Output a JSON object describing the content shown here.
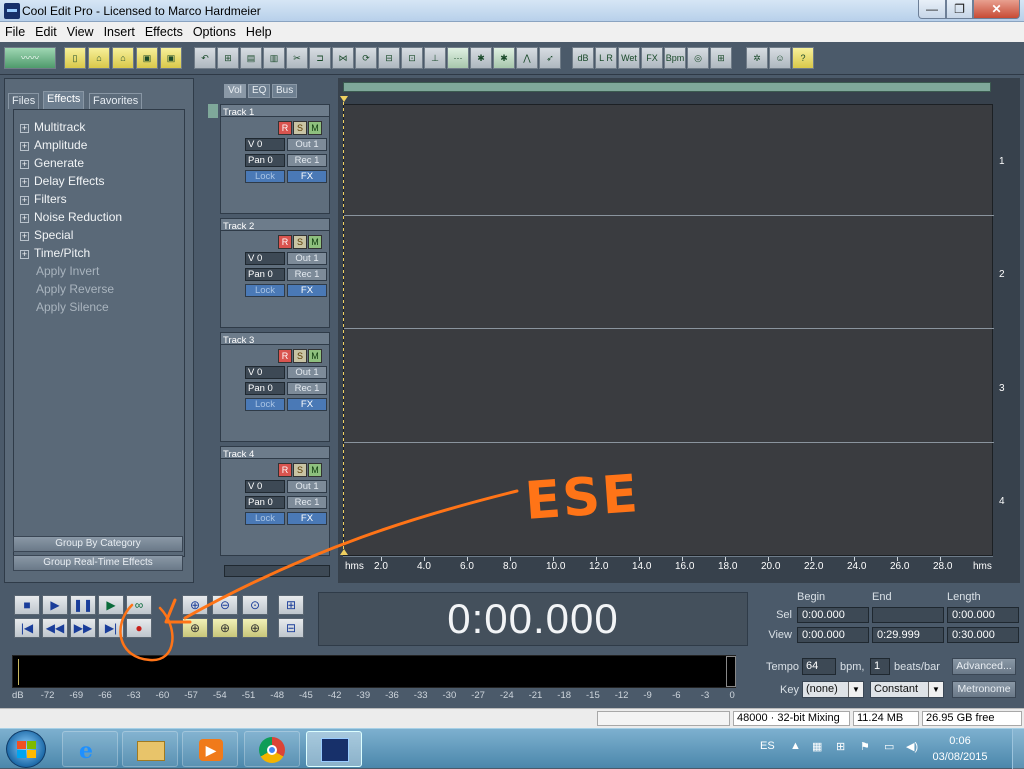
{
  "window": {
    "title": "Cool Edit Pro - Licensed to Marco Hardmeier",
    "min_glyph": "—",
    "max_glyph": "❐",
    "close_glyph": "✕"
  },
  "menu": [
    "File",
    "Edit",
    "View",
    "Insert",
    "Effects",
    "Options",
    "Help"
  ],
  "toolbar": {
    "icons": [
      "waveform-toggle-icon",
      "new-icon",
      "open-icon",
      "open-append-icon",
      "save-icon",
      "save-all-icon",
      "undo-icon",
      "insert-icon",
      "mix-paste-icon",
      "cut-icon",
      "trim-icon",
      "split-icon",
      "merge-icon",
      "loop-icon",
      "group-icon",
      "ungroup-icon",
      "lock-icon",
      "snap-icon",
      "zoom-select-icon",
      "envelope-icon",
      "edit-icon",
      "pan-icon",
      "vol-icon",
      "wet-icon",
      "fx-icon",
      "bpm-icon",
      "sound-icon",
      "cd-icon",
      "mixer-icon",
      "help-icon"
    ],
    "wet_label": "Wet",
    "fx_label": "FX",
    "bpm_label": "Bpm",
    "help_label": "?"
  },
  "left_panel": {
    "tabs": [
      "Files",
      "Effects",
      "Favorites"
    ],
    "active_tab": "Effects",
    "tree": [
      {
        "label": "Multitrack",
        "expandable": true
      },
      {
        "label": "Amplitude",
        "expandable": true
      },
      {
        "label": "Generate",
        "expandable": true
      },
      {
        "label": "Delay Effects",
        "expandable": true
      },
      {
        "label": "Filters",
        "expandable": true
      },
      {
        "label": "Noise Reduction",
        "expandable": true
      },
      {
        "label": "Special",
        "expandable": true
      },
      {
        "label": "Time/Pitch",
        "expandable": true
      },
      {
        "label": "Apply Invert",
        "expandable": false
      },
      {
        "label": "Apply Reverse",
        "expandable": false
      },
      {
        "label": "Apply Silence",
        "expandable": false
      }
    ],
    "group_by_category": "Group By Category",
    "group_realtime": "Group Real-Time Effects"
  },
  "track_tabs": [
    "Vol",
    "EQ",
    "Bus"
  ],
  "tracks": [
    {
      "name": "Track 1",
      "r": "R",
      "s": "S",
      "m": "M",
      "vol": "V 0",
      "out": "Out 1",
      "pan": "Pan 0",
      "rec": "Rec 1",
      "lock": "Lock",
      "fx": "FX"
    },
    {
      "name": "Track 2",
      "r": "R",
      "s": "S",
      "m": "M",
      "vol": "V 0",
      "out": "Out 1",
      "pan": "Pan 0",
      "rec": "Rec 1",
      "lock": "Lock",
      "fx": "FX"
    },
    {
      "name": "Track 3",
      "r": "R",
      "s": "S",
      "m": "M",
      "vol": "V 0",
      "out": "Out 1",
      "pan": "Pan 0",
      "rec": "Rec 1",
      "lock": "Lock",
      "fx": "FX"
    },
    {
      "name": "Track 4",
      "r": "R",
      "s": "S",
      "m": "M",
      "vol": "V 0",
      "out": "Out 1",
      "pan": "Pan 0",
      "rec": "Rec 1",
      "lock": "Lock",
      "fx": "FX"
    }
  ],
  "lane_numbers": [
    "1",
    "2",
    "3",
    "4"
  ],
  "ruler": {
    "unit": "hms",
    "ticks": [
      "2.0",
      "4.0",
      "6.0",
      "8.0",
      "10.0",
      "12.0",
      "14.0",
      "16.0",
      "18.0",
      "20.0",
      "22.0",
      "24.0",
      "26.0",
      "28.0"
    ]
  },
  "transport": {
    "stop": "■",
    "play": "▶",
    "pause": "❚❚",
    "play_to_end": "▶",
    "loop": "∞",
    "go_start": "|◀",
    "rewind": "◀◀",
    "fast_forward": "▶▶",
    "go_end": "▶|",
    "record": "●"
  },
  "time_display": "0:00.000",
  "selection": {
    "headers": [
      "Begin",
      "End",
      "Length"
    ],
    "sel_label": "Sel",
    "view_label": "View",
    "sel": [
      "0:00.000",
      "",
      "0:00.000"
    ],
    "view": [
      "0:00.000",
      "0:29.999",
      "0:30.000"
    ]
  },
  "level_meter": {
    "db_scale": [
      "dB",
      "-72",
      "-69",
      "-66",
      "-63",
      "-60",
      "-57",
      "-54",
      "-51",
      "-48",
      "-45",
      "-42",
      "-39",
      "-36",
      "-33",
      "-30",
      "-27",
      "-24",
      "-21",
      "-18",
      "-15",
      "-12",
      "-9",
      "-6",
      "-3",
      "0"
    ]
  },
  "tempo": {
    "tempo_label": "Tempo",
    "tempo_value": "64",
    "bpm_label": "bpm,",
    "beats_value": "1",
    "beats_label": "beats/bar",
    "advanced_button": "Advanced...",
    "key_label": "Key",
    "key_value": "(none)",
    "mode_value": "Constant",
    "metronome_button": "Metronome"
  },
  "status": {
    "mixing": "48000 · 32-bit Mixing",
    "memory": "11.24 MB",
    "disk_free": "26.95 GB free"
  },
  "taskbar": {
    "language": "ES",
    "time": "0:06",
    "date": "03/08/2015",
    "apps": [
      "internet-explorer-icon",
      "file-explorer-icon",
      "media-player-icon",
      "chrome-icon",
      "cool-edit-icon"
    ]
  },
  "annotation": {
    "text": "ESE",
    "color": "#ff7417"
  }
}
